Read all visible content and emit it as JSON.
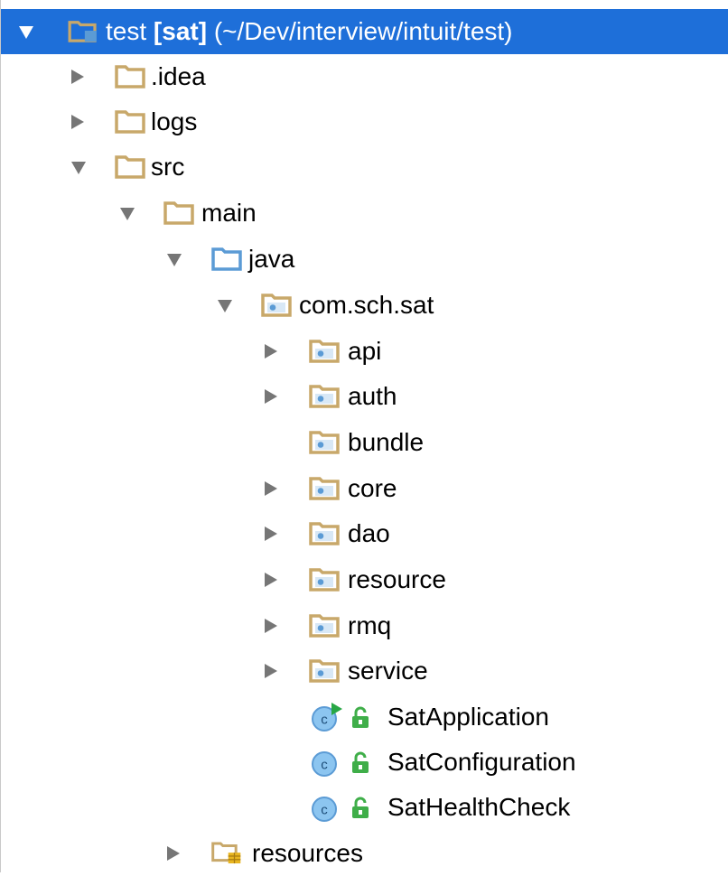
{
  "tree": {
    "root": {
      "name": "test",
      "module": "[sat]",
      "path": "(~/Dev/interview/intuit/test)",
      "icon": "module-folder-icon",
      "expanded": true
    },
    "rows": [
      {
        "label": ".idea",
        "icon": "folder-icon",
        "expanded": false
      },
      {
        "label": "logs",
        "icon": "folder-icon",
        "expanded": false
      },
      {
        "label": "src",
        "icon": "folder-icon",
        "expanded": true
      },
      {
        "label": "main",
        "icon": "folder-icon",
        "expanded": true
      },
      {
        "label": "java",
        "icon": "source-root-folder-icon",
        "expanded": true
      },
      {
        "label": "com.sch.sat",
        "icon": "package-folder-icon",
        "expanded": true
      },
      {
        "label": "api",
        "icon": "package-folder-icon",
        "expanded": false
      },
      {
        "label": "auth",
        "icon": "package-folder-icon",
        "expanded": false
      },
      {
        "label": "bundle",
        "icon": "package-folder-icon",
        "expanded": null
      },
      {
        "label": "core",
        "icon": "package-folder-icon",
        "expanded": false
      },
      {
        "label": "dao",
        "icon": "package-folder-icon",
        "expanded": false
      },
      {
        "label": "resource",
        "icon": "package-folder-icon",
        "expanded": false
      },
      {
        "label": "rmq",
        "icon": "package-folder-icon",
        "expanded": false
      },
      {
        "label": "service",
        "icon": "package-folder-icon",
        "expanded": false
      },
      {
        "label": "SatApplication",
        "icon": "runnable-class-icon",
        "access": "public-lock-icon"
      },
      {
        "label": "SatConfiguration",
        "icon": "class-icon",
        "access": "public-lock-icon"
      },
      {
        "label": "SatHealthCheck",
        "icon": "class-icon",
        "access": "public-lock-icon"
      },
      {
        "label": "resources",
        "icon": "resources-root-folder-icon",
        "expanded": false
      }
    ]
  },
  "colors": {
    "selection": "#1e6fd9",
    "folder": "#c8a86a",
    "source_folder": "#5b9bd5",
    "class_circle": "#8cc5f0",
    "lock_green": "#3fae49",
    "run_green": "#28a745",
    "arrow": "#767676"
  }
}
